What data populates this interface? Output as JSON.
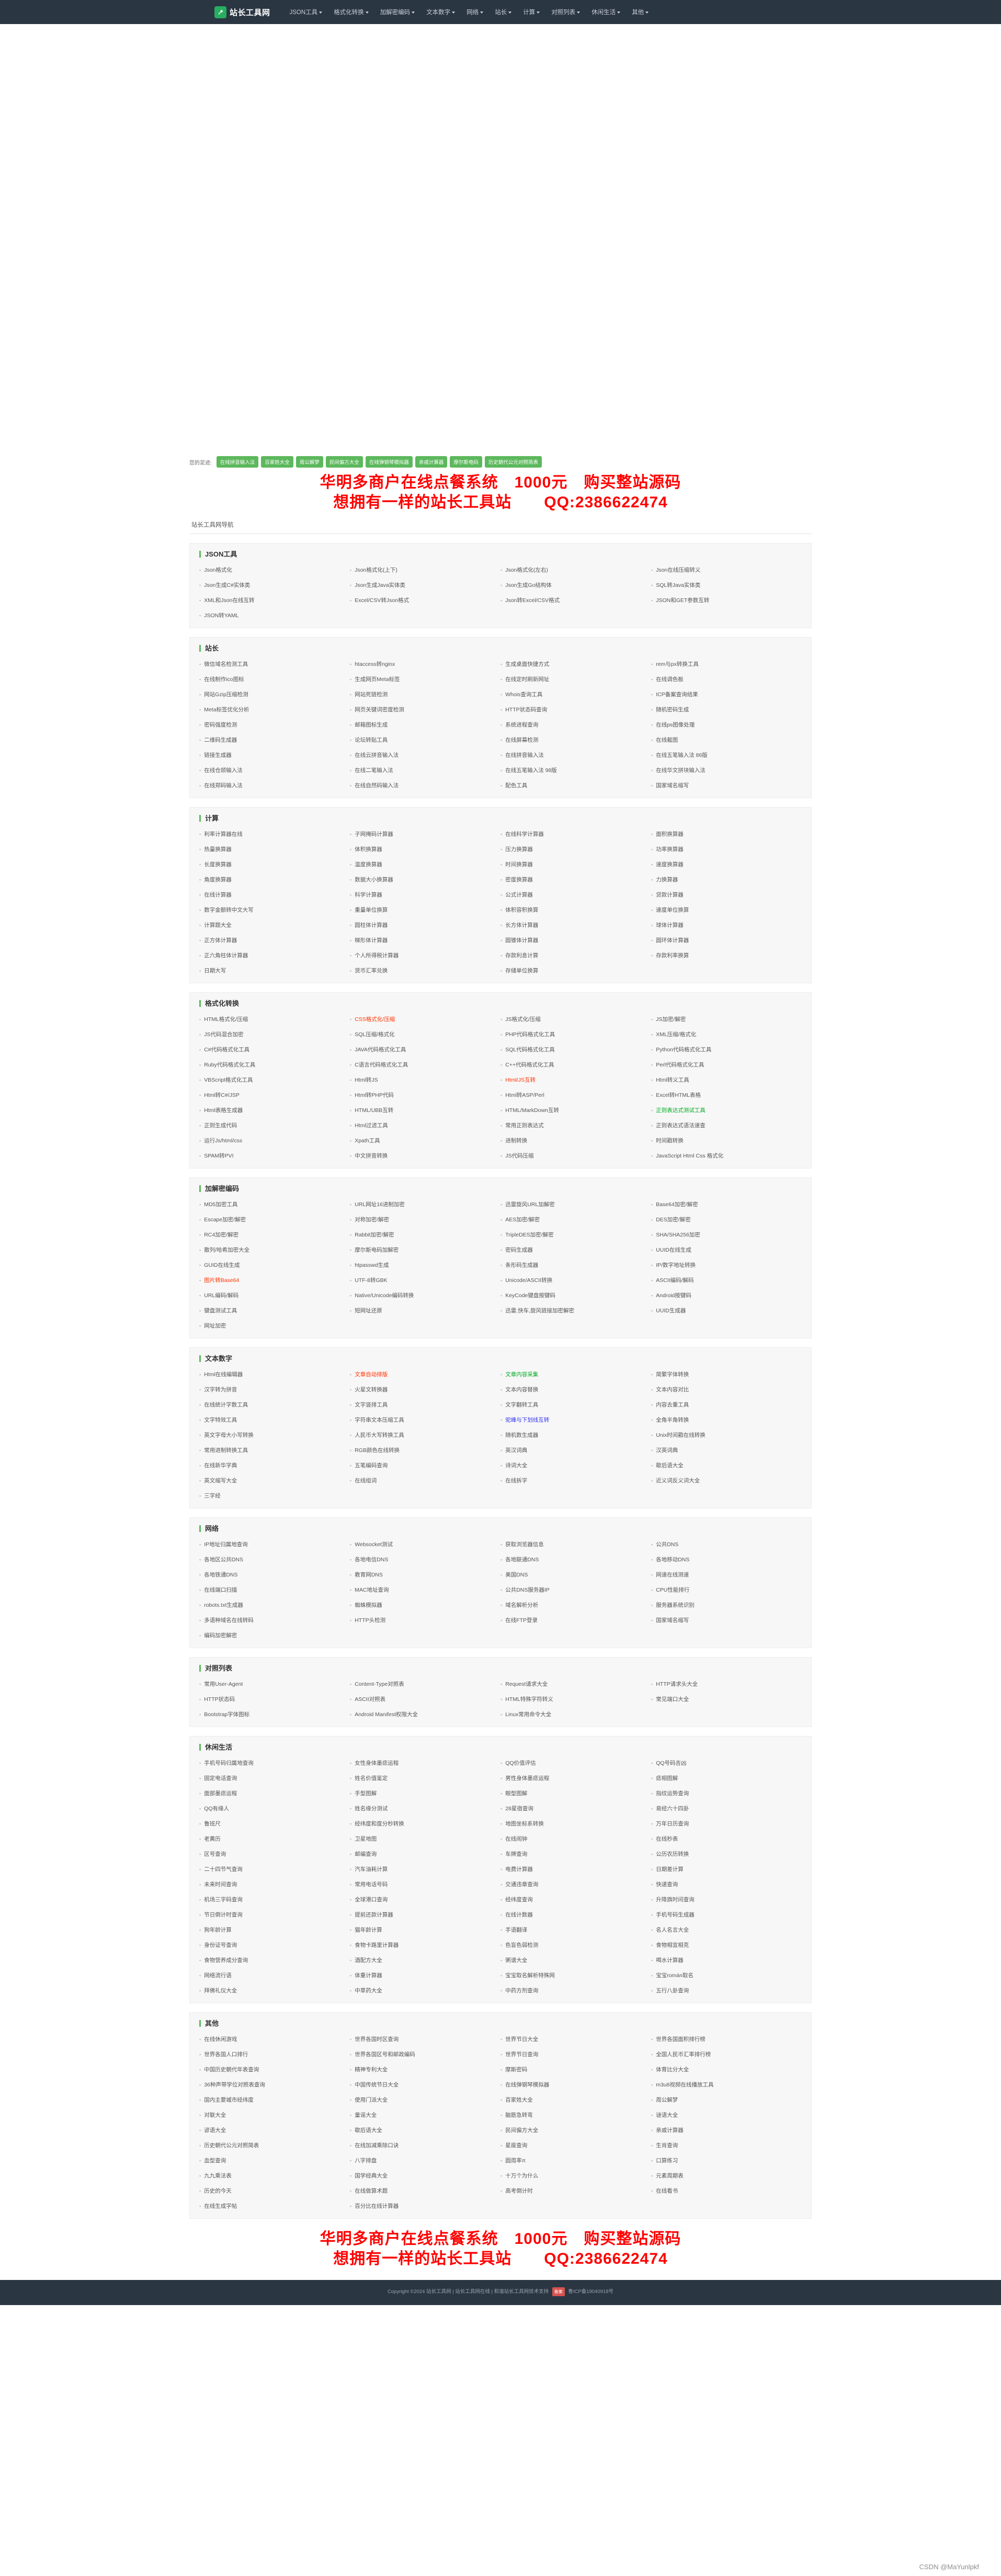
{
  "header": {
    "brand": "站长工具网",
    "logo_icon": "wrench-icon",
    "nav": [
      {
        "label": "JSON工具"
      },
      {
        "label": "格式化转换"
      },
      {
        "label": "加解密编码"
      },
      {
        "label": "文本数字"
      },
      {
        "label": "网络"
      },
      {
        "label": "站长"
      },
      {
        "label": "计算"
      },
      {
        "label": "对照列表"
      },
      {
        "label": "休闲生活"
      },
      {
        "label": "其他"
      }
    ]
  },
  "footprint": {
    "label": "您的足迹:",
    "tags": [
      "在线拼音输入法",
      "百家姓大全",
      "周公解梦",
      "民间偏方大全",
      "在线弹钢琴模拟器",
      "亲戚计算器",
      "摩尔斯电码",
      "历史朝代公元对照简表"
    ]
  },
  "promo": {
    "line1": "华明多商户在线点餐系统　1000元　购买整站源码",
    "line2": "想拥有一样的站长工具站　　QQ:2386622474"
  },
  "subtitle": "站长工具网导航",
  "sections": [
    {
      "title": "JSON工具",
      "links": [
        {
          "label": "Json格式化"
        },
        {
          "label": "Json格式化(上下)"
        },
        {
          "label": "Json格式化(左右)"
        },
        {
          "label": "Json在线压缩转义"
        },
        {
          "label": "Json生成C#实体类"
        },
        {
          "label": "Json生成Java实体类"
        },
        {
          "label": "Json生成Go结构体"
        },
        {
          "label": "SQL转Java实体类"
        },
        {
          "label": "XML和Json在线互转"
        },
        {
          "label": "Excel/CSV转Json格式"
        },
        {
          "label": "Json转Excel/CSV格式"
        },
        {
          "label": "JSON和GET参数互转"
        },
        {
          "label": "JSON转YAML"
        }
      ]
    },
    {
      "title": "站长",
      "links": [
        {
          "label": "微信域名检测工具"
        },
        {
          "label": "htaccess转nginx"
        },
        {
          "label": "生成桌面快捷方式"
        },
        {
          "label": "rem与px转换工具"
        },
        {
          "label": "在线制作ico图标"
        },
        {
          "label": "生成网页Meta标签"
        },
        {
          "label": "在线定时刷新网址"
        },
        {
          "label": "在线调色板"
        },
        {
          "label": "网站Gzip压缩检测"
        },
        {
          "label": "网站死链检测"
        },
        {
          "label": "Whois查询工具"
        },
        {
          "label": "ICP备案查询结果"
        },
        {
          "label": "Meta标签优化分析"
        },
        {
          "label": "网页关键词密度检测"
        },
        {
          "label": "HTTP状态码查询"
        },
        {
          "label": "随机密码生成"
        },
        {
          "label": "密码强度检测"
        },
        {
          "label": "邮箱图标生成"
        },
        {
          "label": "系统进程查询"
        },
        {
          "label": "在线ps图像处理"
        },
        {
          "label": "二维码生成器"
        },
        {
          "label": "论坛转贴工具"
        },
        {
          "label": "在线屏幕检测"
        },
        {
          "label": "在线截图"
        },
        {
          "label": "链接生成器"
        },
        {
          "label": "在线云拼音输入法"
        },
        {
          "label": "在线拼音输入法"
        },
        {
          "label": "在线五笔输入法 86版"
        },
        {
          "label": "在线仓颉输入法"
        },
        {
          "label": "在线二笔输入法"
        },
        {
          "label": "在线五笔输入法 98版"
        },
        {
          "label": "在线华文拼块输入法"
        },
        {
          "label": "在线郑码输入法"
        },
        {
          "label": "在线自然码输入法"
        },
        {
          "label": "配色工具"
        },
        {
          "label": "国家域名缩写"
        }
      ]
    },
    {
      "title": "计算",
      "links": [
        {
          "label": "利率计算器在线"
        },
        {
          "label": "子网掩码计算器"
        },
        {
          "label": "在线科学计算器"
        },
        {
          "label": "面积换算器"
        },
        {
          "label": "热量换算器"
        },
        {
          "label": "体积换算器"
        },
        {
          "label": "压力换算器"
        },
        {
          "label": "功率换算器"
        },
        {
          "label": "长度换算器"
        },
        {
          "label": "温度换算器"
        },
        {
          "label": "时间换算器"
        },
        {
          "label": "速度换算器"
        },
        {
          "label": "角度换算器"
        },
        {
          "label": "数据大小换算器"
        },
        {
          "label": "密度换算器"
        },
        {
          "label": "力换算器"
        },
        {
          "label": "在线计算器"
        },
        {
          "label": "科学计算器"
        },
        {
          "label": "公式计算器"
        },
        {
          "label": "贷款计算器"
        },
        {
          "label": "数字金额转中文大写"
        },
        {
          "label": "重量单位换算"
        },
        {
          "label": "体积容积换算"
        },
        {
          "label": "速度单位换算"
        },
        {
          "label": "计算题大全"
        },
        {
          "label": "圆柱体计算器"
        },
        {
          "label": "长方体计算器"
        },
        {
          "label": "球体计算器"
        },
        {
          "label": "正方体计算器"
        },
        {
          "label": "梯形体计算器"
        },
        {
          "label": "圆锥体计算器"
        },
        {
          "label": "圆环体计算器"
        },
        {
          "label": "正六角柱体计算器"
        },
        {
          "label": "个人所得税计算器"
        },
        {
          "label": "存款利息计算"
        },
        {
          "label": "存款利率换算"
        },
        {
          "label": "日期大写"
        },
        {
          "label": "货币汇率兑换"
        },
        {
          "label": "存储单位换算"
        }
      ]
    },
    {
      "title": "格式化转换",
      "links": [
        {
          "label": "HTML格式化/压缩"
        },
        {
          "label": "CSS格式化/压缩",
          "color": "red"
        },
        {
          "label": "JS格式化/压缩"
        },
        {
          "label": "JS加密/解密"
        },
        {
          "label": " JS代码混合加密"
        },
        {
          "label": "SQL压缩/格式化"
        },
        {
          "label": "PHP代码格式化工具"
        },
        {
          "label": "XML压缩/格式化"
        },
        {
          "label": "C#代码格式化工具"
        },
        {
          "label": "JAVA代码格式化工具"
        },
        {
          "label": "SQL代码格式化工具"
        },
        {
          "label": "Python代码格式化工具"
        },
        {
          "label": "Ruby代码格式化工具"
        },
        {
          "label": "C语言代码格式化工具"
        },
        {
          "label": "C++代码格式化工具"
        },
        {
          "label": "Perl代码格式化工具"
        },
        {
          "label": "VBScript格式化工具"
        },
        {
          "label": " Html转JS"
        },
        {
          "label": "Html/JS互转",
          "color": "red"
        },
        {
          "label": " Html转义工具"
        },
        {
          "label": " Html转C#/JSP"
        },
        {
          "label": "Html转PHP代码"
        },
        {
          "label": "Html转ASP/Perl"
        },
        {
          "label": "Excel转HTML表格"
        },
        {
          "label": "Html表格生成器"
        },
        {
          "label": "HTML/UBB互转"
        },
        {
          "label": "HTML/MarkDown互转"
        },
        {
          "label": "正则表达式测试工具",
          "color": "green"
        },
        {
          "label": "正则生成代码"
        },
        {
          "label": "Html过滤工具"
        },
        {
          "label": "常用正则表达式"
        },
        {
          "label": "正则表达式语法速查"
        },
        {
          "label": "运行Js/html/css"
        },
        {
          "label": "Xpath工具"
        },
        {
          "label": "进制转换"
        },
        {
          "label": "时间戳转换"
        },
        {
          "label": "SPAM转PVI"
        },
        {
          "label": "中文拼音转换"
        },
        {
          "label": "JS代码压缩"
        },
        {
          "label": "JavaScript Html Css 格式化"
        }
      ]
    },
    {
      "title": "加解密编码",
      "links": [
        {
          "label": "MD5加密工具"
        },
        {
          "label": "URL网址16进制加密"
        },
        {
          "label": "迅雷旋风URL加解密"
        },
        {
          "label": " Base64加密/解密"
        },
        {
          "label": "Escape加密/解密"
        },
        {
          "label": "对称加密/解密"
        },
        {
          "label": "AES加密/解密"
        },
        {
          "label": "DES加密/解密"
        },
        {
          "label": "RC4加密/解密"
        },
        {
          "label": "Rabbit加密/解密"
        },
        {
          "label": "TripleDES加密/解密"
        },
        {
          "label": "SHA/SHA256加密"
        },
        {
          "label": "散列/哈希加密大全"
        },
        {
          "label": "摩尔斯电码加解密"
        },
        {
          "label": "密码生成器"
        },
        {
          "label": "UUID在线生成"
        },
        {
          "label": "GUID在线生成"
        },
        {
          "label": "htpasswd生成"
        },
        {
          "label": "条形码生成器"
        },
        {
          "label": "IP/数字地址转换"
        },
        {
          "label": " 图片转Base64",
          "color": "red"
        },
        {
          "label": "UTF-8转GBK"
        },
        {
          "label": "Unicode/ASCII转换"
        },
        {
          "label": "ASCII编码/解码"
        },
        {
          "label": "URL编码/解码"
        },
        {
          "label": "Native/Unicode编码转换"
        },
        {
          "label": "KeyCode键盘按键码"
        },
        {
          "label": "Android按键码"
        },
        {
          "label": "键盘测试工具"
        },
        {
          "label": "短网址还原"
        },
        {
          "label": "迅雷,快车,旋风链接加密解密"
        },
        {
          "label": "UUID生成器"
        },
        {
          "label": "网址加密"
        }
      ]
    },
    {
      "title": "文本数字",
      "links": [
        {
          "label": "Html在线编辑器"
        },
        {
          "label": "文章自动排版",
          "color": "red"
        },
        {
          "label": "文章内容采集",
          "color": "green"
        },
        {
          "label": "简繁字体转换"
        },
        {
          "label": "汉字转为拼音"
        },
        {
          "label": "火星文转换器"
        },
        {
          "label": "文本内容替换"
        },
        {
          "label": " 文本内容对比"
        },
        {
          "label": "在线统计字数工具"
        },
        {
          "label": "文字竖排工具"
        },
        {
          "label": "文字翻转工具"
        },
        {
          "label": "内容去重工具"
        },
        {
          "label": "文字特效工具"
        },
        {
          "label": "字符串文本压缩工具"
        },
        {
          "label": "驼峰与下划线互转",
          "color": "blue"
        },
        {
          "label": "全角半角转换"
        },
        {
          "label": "英文字母大小写转换"
        },
        {
          "label": "人民币大写转换工具"
        },
        {
          "label": "随机数生成器"
        },
        {
          "label": "Unix时间戳在线转换"
        },
        {
          "label": "常用进制转换工具"
        },
        {
          "label": "RGB颜色在线转换"
        },
        {
          "label": "英汉词典"
        },
        {
          "label": "汉英词典"
        },
        {
          "label": "在线新华字典"
        },
        {
          "label": "五笔编码查询"
        },
        {
          "label": "诗词大全"
        },
        {
          "label": "歇后语大全"
        },
        {
          "label": "英文缩写大全"
        },
        {
          "label": "在线组词"
        },
        {
          "label": "在线拆字"
        },
        {
          "label": "近义词反义词大全"
        },
        {
          "label": "三字经"
        }
      ]
    },
    {
      "title": "网络",
      "links": [
        {
          "label": "IP地址归属地查询"
        },
        {
          "label": "Websocket测试"
        },
        {
          "label": "获取浏览器信息"
        },
        {
          "label": "公共DNS"
        },
        {
          "label": "各地区公共DNS"
        },
        {
          "label": "各地电信DNS"
        },
        {
          "label": "各地联通DNS"
        },
        {
          "label": "各地移动DNS"
        },
        {
          "label": "各地铁通DNS"
        },
        {
          "label": "教育网DNS"
        },
        {
          "label": "美国DNS"
        },
        {
          "label": "网速在线测速"
        },
        {
          "label": "在线端口扫描"
        },
        {
          "label": "MAC地址查询"
        },
        {
          "label": "公共DNS服务器IP"
        },
        {
          "label": "CPU性能排行"
        },
        {
          "label": "robots.txt生成器"
        },
        {
          "label": "蜘蛛模拟器"
        },
        {
          "label": "域名解析分析"
        },
        {
          "label": "服务器系统识别"
        },
        {
          "label": "多语种域名在线转码"
        },
        {
          "label": "HTTP头检测"
        },
        {
          "label": "在线FTP登录"
        },
        {
          "label": "国家域名缩写"
        },
        {
          "label": "编码加密解密"
        }
      ]
    },
    {
      "title": "对照列表",
      "links": [
        {
          "label": "常用User-Agent"
        },
        {
          "label": "Content-Type对照表"
        },
        {
          "label": "Request请求大全"
        },
        {
          "label": "HTTP请求头大全"
        },
        {
          "label": "HTTP状态码"
        },
        {
          "label": "ASCII对照表"
        },
        {
          "label": "HTML特殊字符转义"
        },
        {
          "label": "常见端口大全"
        },
        {
          "label": "Bootstrap字体图标"
        },
        {
          "label": " Android Manifest权限大全"
        },
        {
          "label": "Linux常用命令大全"
        }
      ]
    },
    {
      "title": "休闲生活",
      "links": [
        {
          "label": "手机号码归属地查询"
        },
        {
          "label": "女性身体墨痣运程"
        },
        {
          "label": "QQ价值评估"
        },
        {
          "label": "QQ号码吉凶"
        },
        {
          "label": "固定电话查询"
        },
        {
          "label": "姓名价值鉴定"
        },
        {
          "label": "男性身体墨痣运程"
        },
        {
          "label": "痣相图解"
        },
        {
          "label": "面部墨痣运程"
        },
        {
          "label": "手型图解"
        },
        {
          "label": "眼型图解"
        },
        {
          "label": "指纹运势查询"
        },
        {
          "label": "QQ有缘人"
        },
        {
          "label": "姓名缘分测试"
        },
        {
          "label": "28星宿查询"
        },
        {
          "label": "易经六十四卦"
        },
        {
          "label": "鲁班尺"
        },
        {
          "label": "经纬度和度分秒转换"
        },
        {
          "label": "地图坐标系转换"
        },
        {
          "label": "万年日历查询"
        },
        {
          "label": "老黄历"
        },
        {
          "label": "卫星地图"
        },
        {
          "label": "在线闹钟"
        },
        {
          "label": "在线秒表"
        },
        {
          "label": "区号查询"
        },
        {
          "label": "邮编查询"
        },
        {
          "label": "车牌查询"
        },
        {
          "label": "公历农历转换"
        },
        {
          "label": "二十四节气查询"
        },
        {
          "label": "汽车油耗计算"
        },
        {
          "label": "电费计算器"
        },
        {
          "label": "日期差计算"
        },
        {
          "label": "未来时间查询"
        },
        {
          "label": "常用电话号码"
        },
        {
          "label": "交通违章查询"
        },
        {
          "label": "快递查询"
        },
        {
          "label": "机场三字码查询"
        },
        {
          "label": "全球港口查询"
        },
        {
          "label": "经纬度查询"
        },
        {
          "label": "升降旗时间查询"
        },
        {
          "label": "节日倒计时查询"
        },
        {
          "label": "提前还款计算器"
        },
        {
          "label": "在线计数器"
        },
        {
          "label": "手机号码生成器"
        },
        {
          "label": "狗年龄计算"
        },
        {
          "label": "猫年龄计算"
        },
        {
          "label": "手语翻译"
        },
        {
          "label": "名人名言大全"
        },
        {
          "label": "身份证号查询"
        },
        {
          "label": "食物卡路里计算器"
        },
        {
          "label": "色盲色弱检测"
        },
        {
          "label": "食物相宜相克"
        },
        {
          "label": "食物营养成分查询"
        },
        {
          "label": "酒配方大全"
        },
        {
          "label": "粥谱大全"
        },
        {
          "label": "喝水计算器"
        },
        {
          "label": "网络流行语"
        },
        {
          "label": "体重计算器"
        },
        {
          "label": "宝宝取名解析特殊网"
        },
        {
          "label": "宝宝román取名"
        },
        {
          "label": "拜佛礼仪大全"
        },
        {
          "label": "中草药大全"
        },
        {
          "label": "中药方剂查询"
        },
        {
          "label": "五行八卦查询"
        }
      ]
    },
    {
      "title": "其他",
      "links": [
        {
          "label": "在线休闲游戏"
        },
        {
          "label": "世界各国时区查询"
        },
        {
          "label": "世界节日大全"
        },
        {
          "label": "世界各国面积排行榜"
        },
        {
          "label": "世界各国人口排行"
        },
        {
          "label": "世界各国区号和邮政编码"
        },
        {
          "label": "世界节日查询"
        },
        {
          "label": "全国人民币汇率排行榜"
        },
        {
          "label": "中国历史朝代年表查询"
        },
        {
          "label": "精神专利大全"
        },
        {
          "label": "摩斯密码"
        },
        {
          "label": "体育比分大全"
        },
        {
          "label": "36种声带学位对照表查询"
        },
        {
          "label": "中国传统节日大全"
        },
        {
          "label": "在线弹钢琴模拟器"
        },
        {
          "label": "m3u8视频在线播放工具"
        },
        {
          "label": "国内主要城市经纬度"
        },
        {
          "label": "使用门派大全"
        },
        {
          "label": "百家姓大全"
        },
        {
          "label": "周公解梦"
        },
        {
          "label": "对联大全"
        },
        {
          "label": "童谣大全"
        },
        {
          "label": "脑筋急转弯"
        },
        {
          "label": "谜语大全"
        },
        {
          "label": "谚语大全"
        },
        {
          "label": "歇后语大全"
        },
        {
          "label": "民间偏方大全"
        },
        {
          "label": "亲戚计算器"
        },
        {
          "label": "历史朝代公元对照简表"
        },
        {
          "label": "在线加减乘除口诀"
        },
        {
          "label": "星座查询"
        },
        {
          "label": "生肖查询"
        },
        {
          "label": "血型查询"
        },
        {
          "label": "八字排盘"
        },
        {
          "label": "圆周率π"
        },
        {
          "label": "口算练习"
        },
        {
          "label": "九九乘法表"
        },
        {
          "label": "国学经典大全"
        },
        {
          "label": "十万个为什么"
        },
        {
          "label": "元素周期表"
        },
        {
          "label": "历史的今天"
        },
        {
          "label": "在线做算术题"
        },
        {
          "label": "高考倒计时"
        },
        {
          "label": "在线看书"
        },
        {
          "label": "在线生成字帖"
        },
        {
          "label": "百分比在线计算器"
        }
      ]
    }
  ],
  "bottom_promo": {
    "line1": "华明多商户在线点餐系统　1000元　购买整站源码",
    "line2": "想拥有一样的站长工具站　　QQ:2386622474"
  },
  "footer": {
    "copyright": "Copyright ©2024 站长工具网 | 站长工具网在线 | 和谐站长工具网技术支持",
    "beian_badge": "备案",
    "beian": "鲁ICP备19040918号"
  },
  "watermark": "CSDN @MaYunlpkf",
  "colors": {
    "nav_bg": "#2b3643",
    "accent_green": "#5cb85c",
    "promo_red": "#ff0000",
    "link_red": "#ff3300",
    "link_green": "#00aa22",
    "link_blue": "#3333ee"
  }
}
